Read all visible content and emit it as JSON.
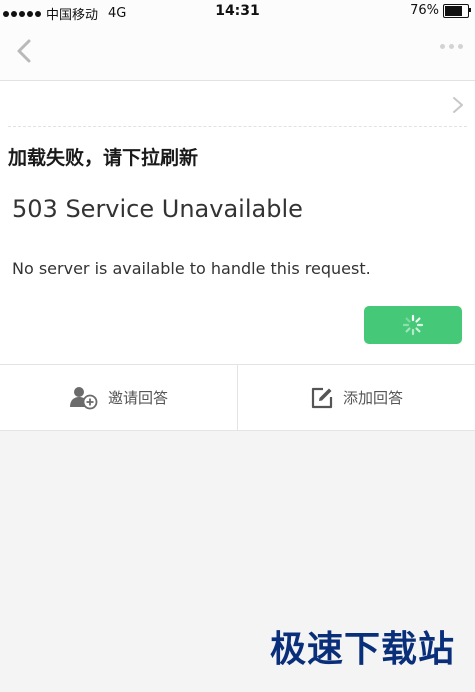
{
  "status_bar": {
    "carrier": "中国移动",
    "network": "4G",
    "time": "14:31",
    "battery": "76%",
    "battery_level": 0.76
  },
  "nav": {
    "back_icon": "chevron-left-icon",
    "more_icon": "more-dots-icon"
  },
  "content": {
    "heading": "加载失败，请下拉刷新",
    "error_title": "503 Service Unavailable",
    "error_message": "No server is available to handle this request.",
    "reload_state": "loading",
    "accent_color": "#45c978"
  },
  "actions": {
    "invite_label": "邀请回答",
    "add_label": "添加回答"
  },
  "watermark": "极速下载站"
}
